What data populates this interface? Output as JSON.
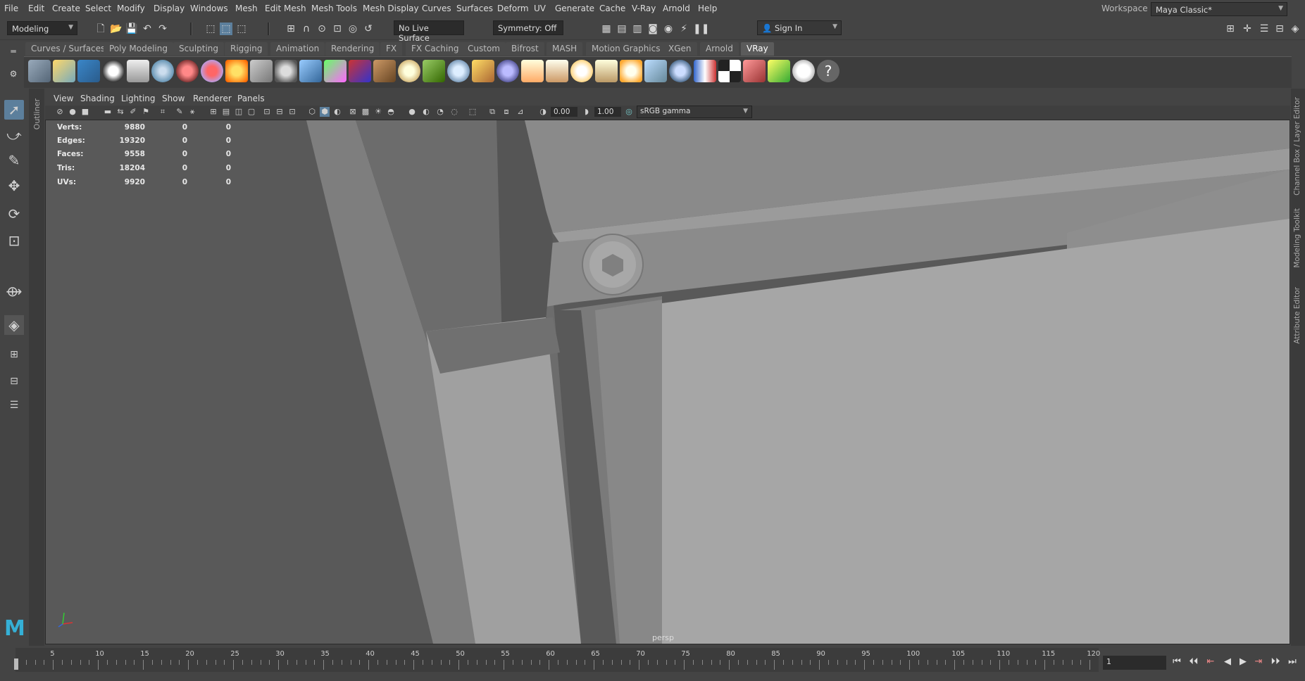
{
  "menubar": {
    "items": [
      "File",
      "Edit",
      "Create",
      "Select",
      "Modify",
      "Display",
      "Windows",
      "Mesh",
      "Edit Mesh",
      "Mesh Tools",
      "Mesh Display",
      "Curves",
      "Surfaces",
      "Deform",
      "UV",
      "Generate",
      "Cache",
      "V-Ray",
      "Arnold",
      "Help"
    ],
    "workspace_label": "Workspace :",
    "workspace_value": "Maya Classic*"
  },
  "statusline": {
    "mode": "Modeling",
    "live_surface": "No Live Surface",
    "symmetry": "Symmetry: Off",
    "sign_in": "Sign In"
  },
  "shelf": {
    "tabs": [
      "Curves / Surfaces",
      "Poly Modeling",
      "Sculpting",
      "Rigging",
      "Animation",
      "Rendering",
      "FX",
      "FX Caching",
      "Custom",
      "Bifrost",
      "MASH",
      "Motion Graphics",
      "XGen",
      "Arnold",
      "VRay"
    ],
    "active_tab": "VRay"
  },
  "outliner": {
    "label": "Outliner"
  },
  "panel": {
    "menus": [
      "View",
      "Shading",
      "Lighting",
      "Show",
      "Renderer",
      "Panels"
    ],
    "exposure": "0.00",
    "gamma": "1.00",
    "color_space": "sRGB gamma",
    "camera": "persp"
  },
  "hud": {
    "rows": [
      {
        "label": "Verts:",
        "v1": "9880",
        "v2": "0",
        "v3": "0"
      },
      {
        "label": "Edges:",
        "v1": "19320",
        "v2": "0",
        "v3": "0"
      },
      {
        "label": "Faces:",
        "v1": "9558",
        "v2": "0",
        "v3": "0"
      },
      {
        "label": "Tris:",
        "v1": "18204",
        "v2": "0",
        "v3": "0"
      },
      {
        "label": "UVs:",
        "v1": "9920",
        "v2": "0",
        "v3": "0"
      }
    ]
  },
  "right_tabs": [
    "Channel Box / Layer Editor",
    "Modeling Toolkit",
    "Attribute Editor"
  ],
  "timeline": {
    "ticks": [
      "1",
      "5",
      "10",
      "15",
      "20",
      "25",
      "30",
      "35",
      "40",
      "45",
      "50",
      "55",
      "60",
      "65",
      "70",
      "75",
      "80",
      "85",
      "90",
      "95",
      "100",
      "105",
      "110",
      "115",
      "120"
    ],
    "current_frame": "1"
  },
  "colors": {
    "active_tool": "#5c7f9c",
    "viewport_bg": "#5a5a5a"
  }
}
